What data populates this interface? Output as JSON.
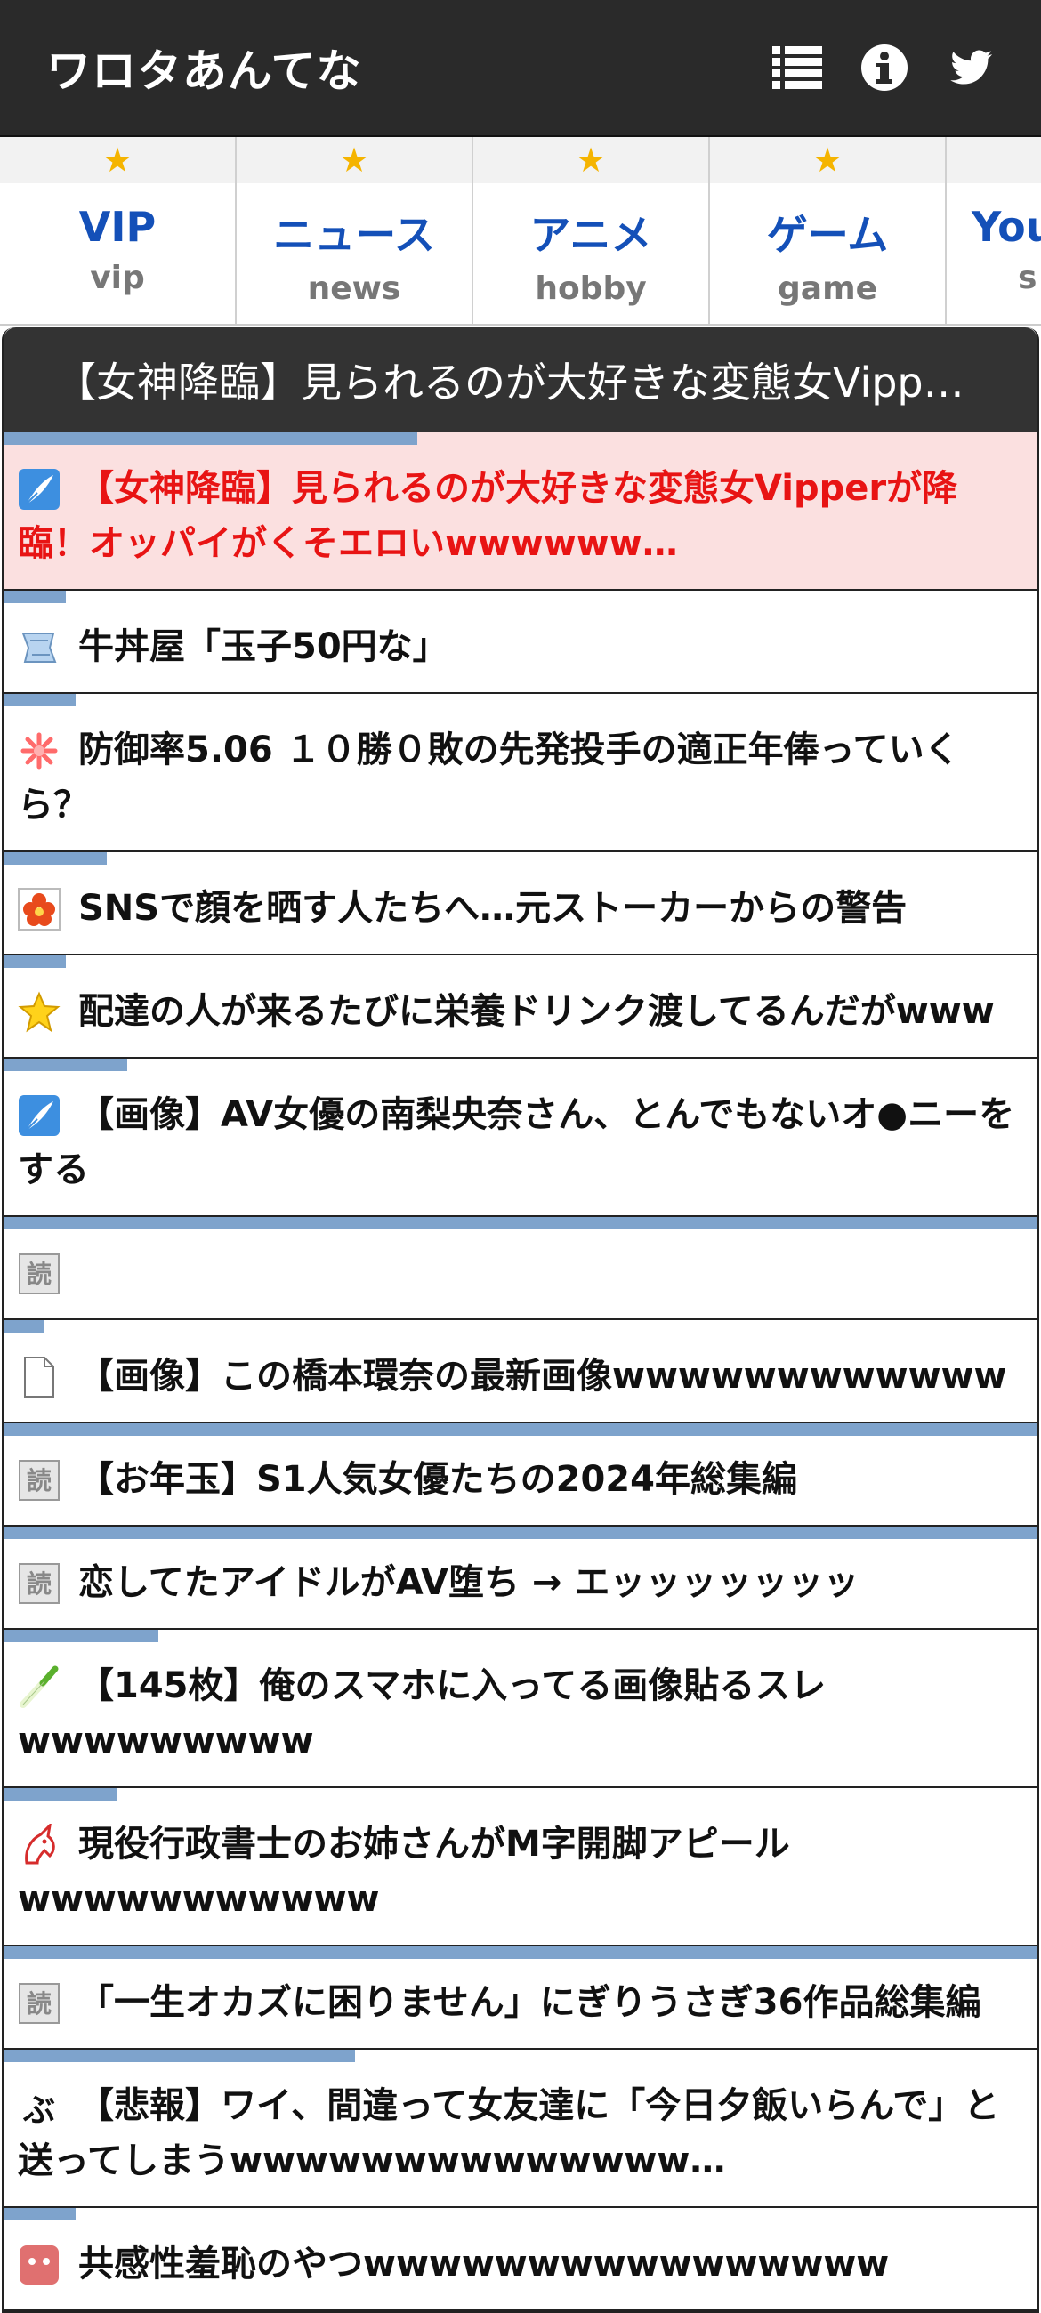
{
  "header": {
    "title": "ワロタあんてな",
    "icons": [
      "list-icon",
      "info-icon",
      "twitter-icon"
    ]
  },
  "tabs": [
    {
      "label": "VIP",
      "sub": "vip"
    },
    {
      "label": "ニュース",
      "sub": "news"
    },
    {
      "label": "アニメ",
      "sub": "hobby"
    },
    {
      "label": "ゲーム",
      "sub": "game"
    },
    {
      "label": "You",
      "sub": "s"
    }
  ],
  "box": {
    "title": "【女神降臨】見られるのが大好きな変態女Vipp…"
  },
  "articles": [
    {
      "title": "【女神降臨】見られるのが大好きな変態女Vipperが降臨！オッパイがくそエロいwwwwww…",
      "icon": "quill-icon",
      "bar": 0.4,
      "highlight": true
    },
    {
      "title": "牛丼屋「玉子50円な」",
      "icon": "scroll-icon",
      "bar": 0.06
    },
    {
      "title": "防御率5.06 １０勝０敗の先発投手の適正年俸っていくら？",
      "icon": "flower-icon",
      "bar": 0.07
    },
    {
      "title": "SNSで顔を晒す人たちへ…元ストーカーからの警告",
      "icon": "red-flower-icon",
      "bar": 0.1
    },
    {
      "title": "配達の人が来るたびに栄養ドリンク渡してるんだがwww",
      "icon": "star-icon",
      "bar": 0.06
    },
    {
      "title": "【画像】AV女優の南梨央奈さん、とんでもないオ●ニーをする",
      "icon": "quill-icon",
      "bar": 0.12
    },
    {
      "title": "",
      "icon": "read-icon",
      "bar": 1.0
    },
    {
      "title": "【画像】この橋本環奈の最新画像wwwwwwwwwwww",
      "icon": "page-icon",
      "bar": 0.04
    },
    {
      "title": "【お年玉】S1人気女優たちの2024年総集編",
      "icon": "read-icon",
      "bar": 1.0
    },
    {
      "title": "恋してたアイドルがAV堕ち → エッッッッッッッ",
      "icon": "read-icon",
      "bar": 1.0
    },
    {
      "title": "【145枚】俺のスマホに入ってる画像貼るスレwwwwwwwww",
      "icon": "leek-icon",
      "bar": 0.15
    },
    {
      "title": "現役行政書士のお姉さんがM字開脚アピール wwwwwwwwwww",
      "icon": "unicorn-icon",
      "bar": 0.11
    },
    {
      "title": "「一生オカズに困りません」にぎりうさぎ36作品総集編",
      "icon": "read-icon",
      "bar": 1.0
    },
    {
      "title": "【悲報】ワイ、間違って女友達に「今日夕飯いらんで」と送ってしまうwwwwwwwwwwwwww…",
      "icon": "bu-icon",
      "bar": 0.34
    },
    {
      "title": "共感性羞恥のやつwwwwwwwwwwwwwwww",
      "icon": "face-icon",
      "bar": 0.07
    }
  ]
}
